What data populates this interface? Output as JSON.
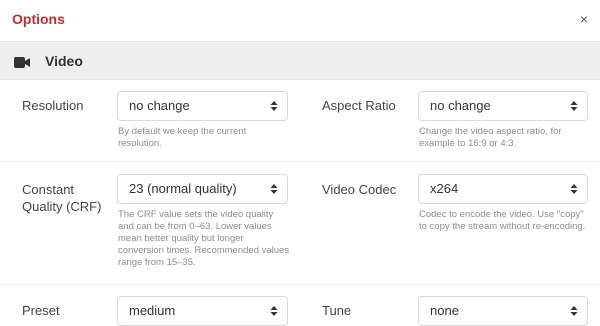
{
  "dialog": {
    "title": "Options",
    "close_label": "×"
  },
  "section": {
    "icon": "video-camera-icon",
    "title": "Video"
  },
  "fields": {
    "resolution": {
      "label": "Resolution",
      "value": "no change",
      "help": "By default we keep the current resolution."
    },
    "aspect_ratio": {
      "label": "Aspect Ratio",
      "value": "no change",
      "help": "Change the video aspect ratio, for example to 16:9 or 4:3."
    },
    "crf": {
      "label": "Constant Quality (CRF)",
      "value": "23 (normal quality)",
      "help": "The CRF value sets the video quality and can be from 0–63. Lower values mean better quality but longer conversion times. Recommended values range from 15–35."
    },
    "video_codec": {
      "label": "Video Codec",
      "value": "x264",
      "help": "Codec to encode the video. Use \"copy\" to copy the stream without re-encoding."
    },
    "preset": {
      "label": "Preset",
      "value": "medium"
    },
    "tune": {
      "label": "Tune",
      "value": "none"
    }
  }
}
